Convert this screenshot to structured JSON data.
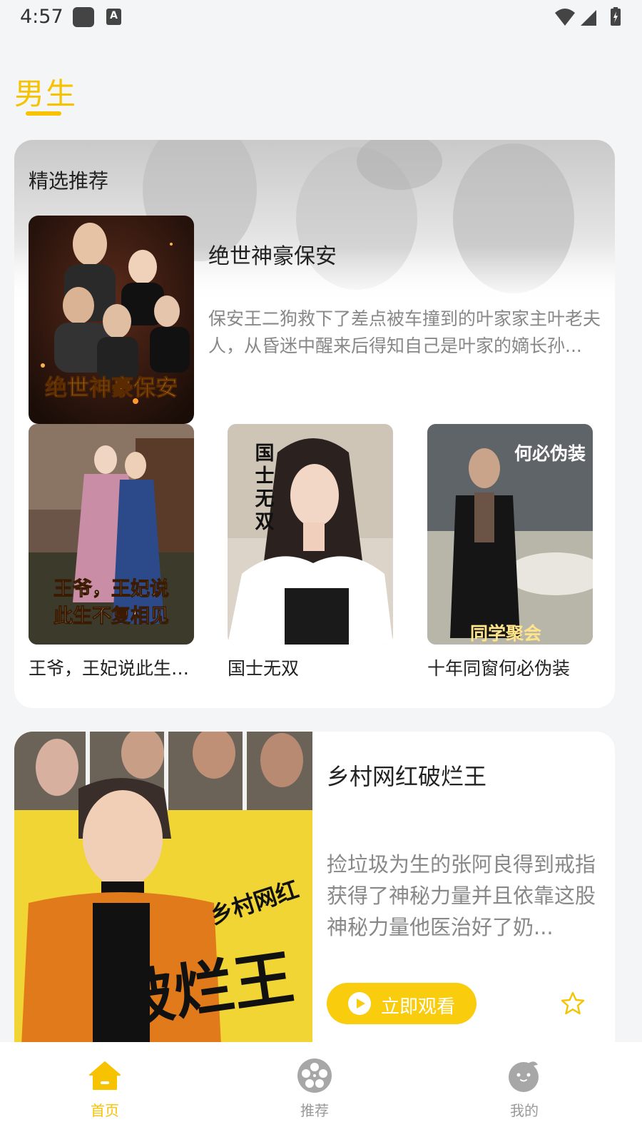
{
  "status_bar": {
    "time": "4:57",
    "notification_icons": [
      "square-icon",
      "a-icon"
    ],
    "system_icons": [
      "wifi-icon",
      "signal-icon",
      "battery-icon"
    ]
  },
  "section_tab": {
    "label": "男生",
    "active_color": "#f7c200"
  },
  "featured": {
    "title": "精选推荐",
    "hero": {
      "name": "绝世神豪保安",
      "poster_text": "绝世神豪保安",
      "description": "保安王二狗救下了差点被车撞到的叶家家主叶老夫人，从昏迷中醒来后得知自己是叶家的嫡长孙..."
    },
    "items": [
      {
        "name": "王爷，王妃说此生不复相见",
        "poster_text": "王爷，王妃说此生不复相见"
      },
      {
        "name": "国士无双",
        "poster_text": "国士无双"
      },
      {
        "name": "十年同窗何必伪装",
        "poster_text": "何必伪装"
      }
    ]
  },
  "card2": {
    "name": "乡村网红破烂王",
    "poster_text_top": "乡村网红",
    "poster_text_main": "破烂王",
    "description": "捡垃圾为生的张阿良得到戒指获得了神秘力量并且依靠这股神秘力量他医治好了奶...",
    "watch_label": "立即观看"
  },
  "bottom_nav": [
    {
      "label": "首页",
      "icon": "home-icon",
      "active": true
    },
    {
      "label": "推荐",
      "icon": "film-reel-icon",
      "active": false
    },
    {
      "label": "我的",
      "icon": "profile-face-icon",
      "active": false
    }
  ],
  "colors": {
    "accent": "#f9cc0d",
    "inactive_nav": "#999999",
    "active_nav": "#f7c200"
  }
}
